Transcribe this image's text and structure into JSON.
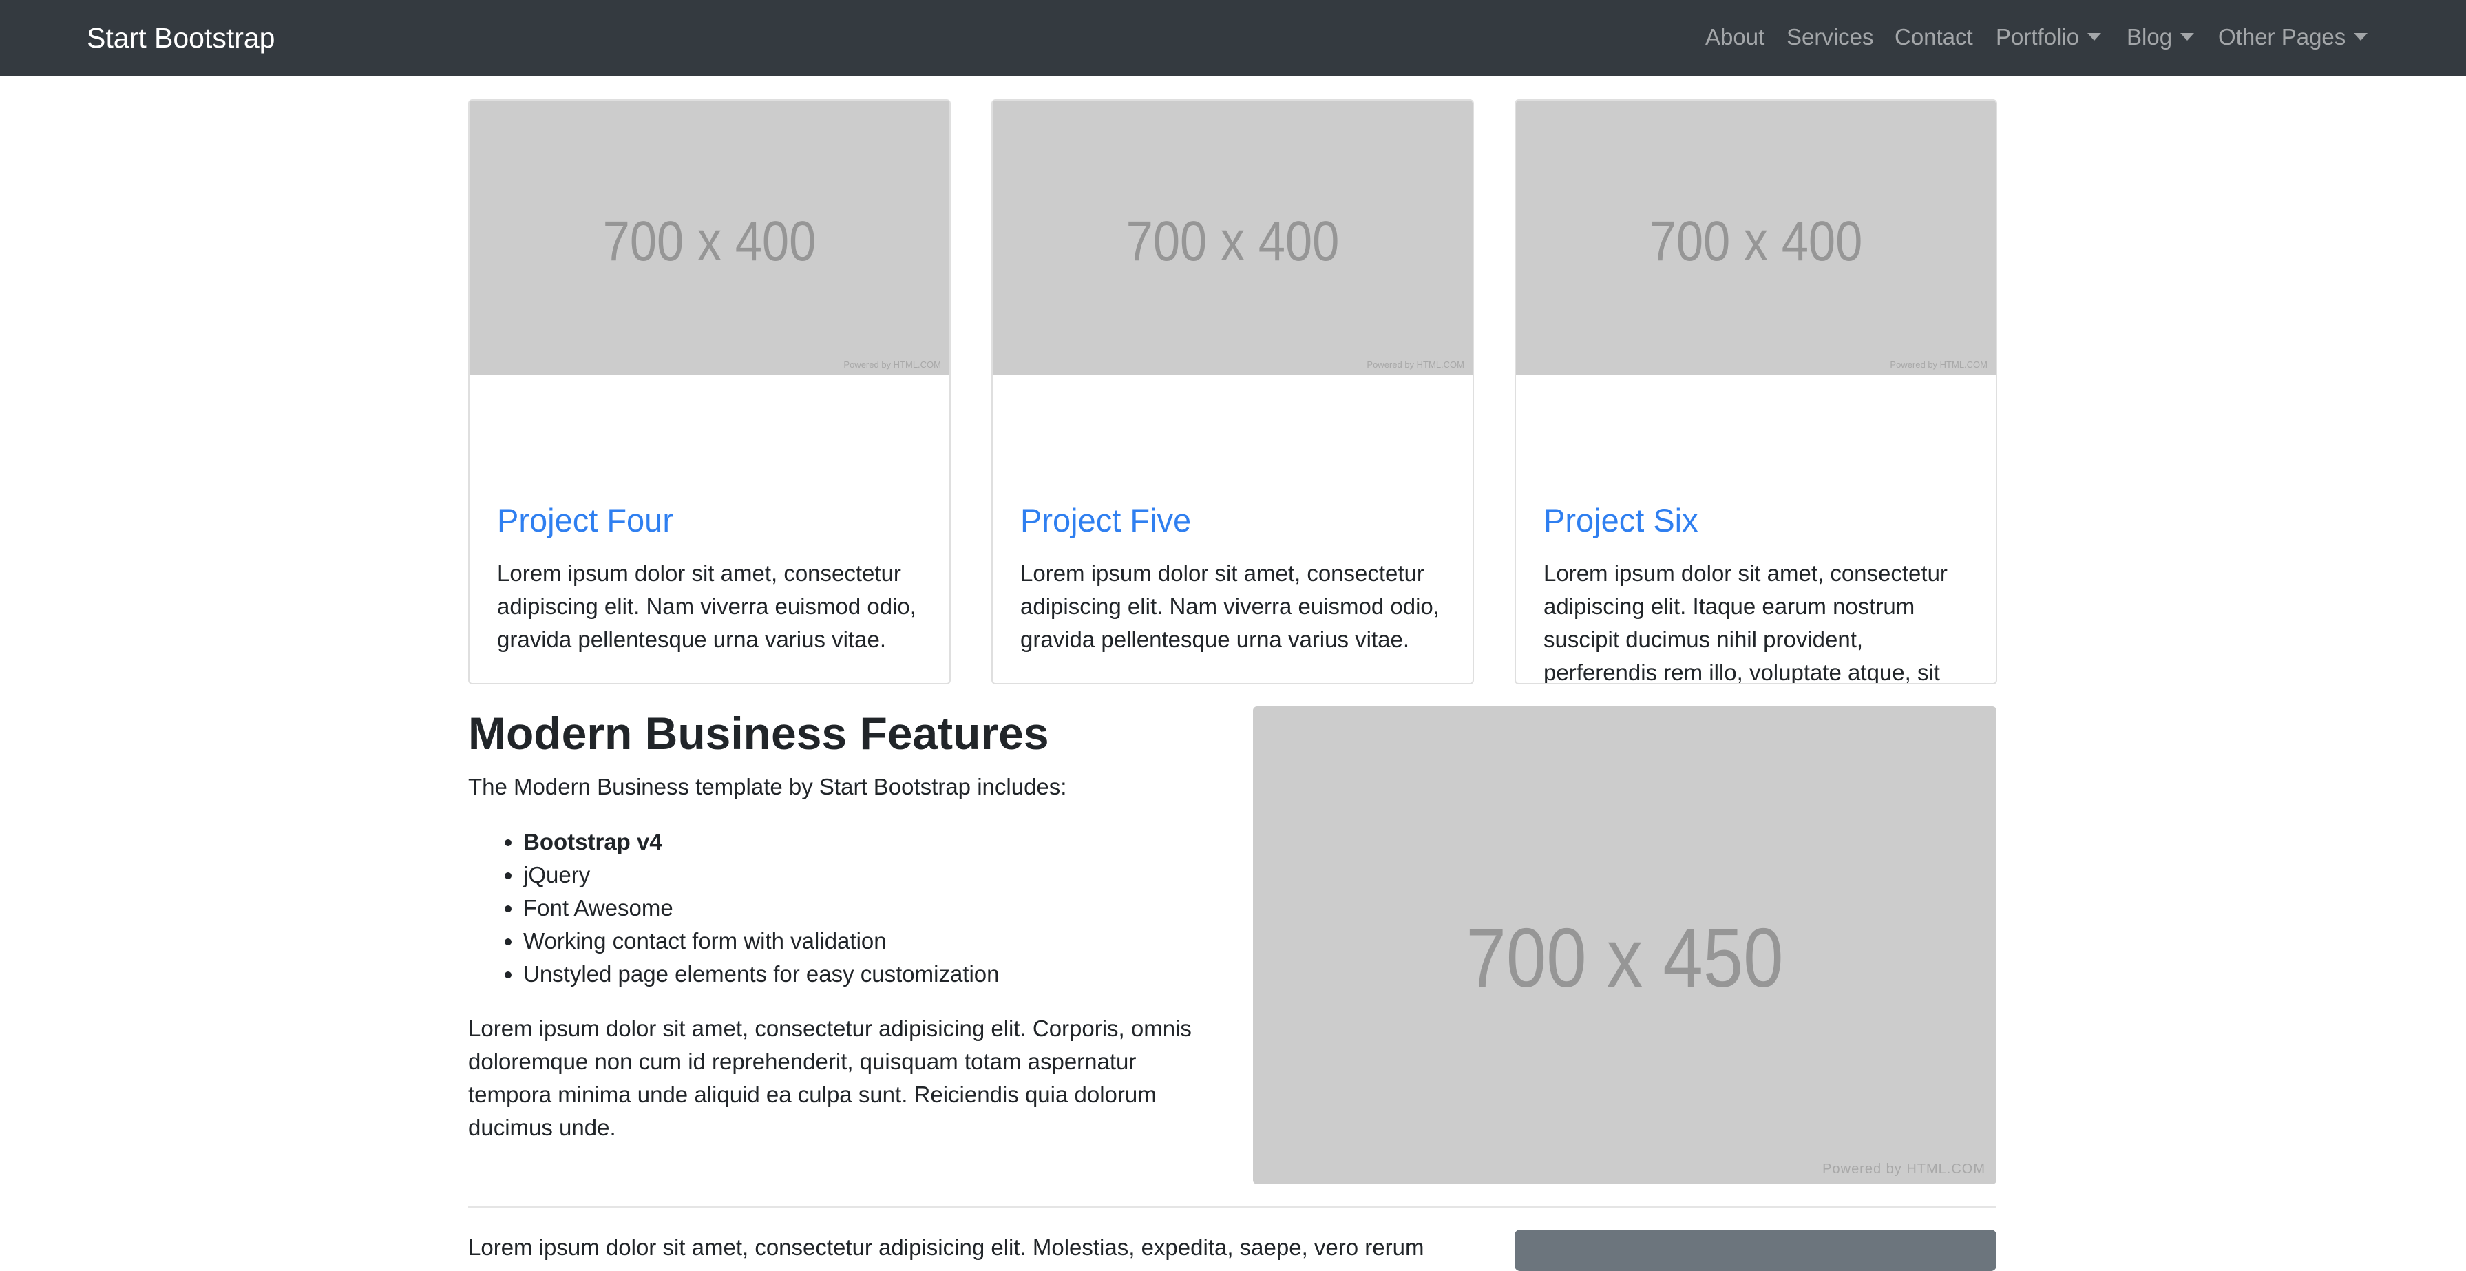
{
  "navbar": {
    "brand": "Start Bootstrap",
    "links": [
      {
        "label": "About"
      },
      {
        "label": "Services"
      },
      {
        "label": "Contact"
      },
      {
        "label": "Portfolio"
      },
      {
        "label": "Blog"
      },
      {
        "label": "Other Pages"
      }
    ]
  },
  "cards": [
    {
      "image_label": "700 x 400",
      "powered": "Powered by HTML.COM",
      "title": "Project Four",
      "text": "Lorem ipsum dolor sit amet, consectetur adipiscing elit. Nam viverra euismod odio, gravida pellentesque urna varius vitae."
    },
    {
      "image_label": "700 x 400",
      "powered": "Powered by HTML.COM",
      "title": "Project Five",
      "text": "Lorem ipsum dolor sit amet, consectetur adipiscing elit. Nam viverra euismod odio, gravida pellentesque urna varius vitae."
    },
    {
      "image_label": "700 x 400",
      "powered": "Powered by HTML.COM",
      "title": "Project Six",
      "text": "Lorem ipsum dolor sit amet, consectetur adipiscing elit. Itaque earum nostrum suscipit ducimus nihil provident, perferendis rem illo, voluptate atque, sit eius in voluptates, nemo repellat fugiat excepturi! Nemo, esse."
    }
  ],
  "features": {
    "title": "Modern Business Features",
    "intro": "The Modern Business template by Start Bootstrap includes:",
    "items": [
      "Bootstrap v4",
      "jQuery",
      "Font Awesome",
      "Working contact form with validation",
      "Unstyled page elements for easy customization"
    ],
    "body": "Lorem ipsum dolor sit amet, consectetur adipisicing elit. Corporis, omnis doloremque non cum id reprehenderit, quisquam totam aspernatur tempora minima unde aliquid ea culpa sunt. Reiciendis quia dolorum ducimus unde.",
    "image_label": "700 x 450",
    "powered": "Powered by HTML.COM"
  },
  "cta": {
    "text": "Lorem ipsum dolor sit amet, consectetur adipisicing elit. Molestias, expedita, saepe, vero rerum"
  }
}
